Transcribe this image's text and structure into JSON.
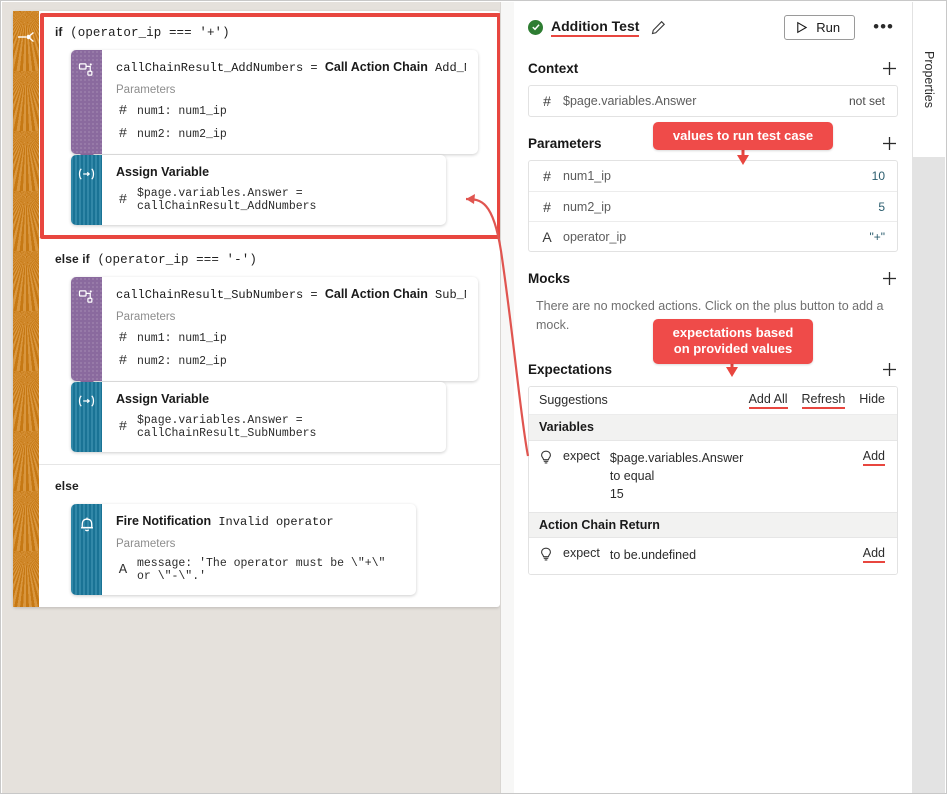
{
  "canvas": {
    "gutter_icon": "action-chain-icon",
    "branches": [
      {
        "label_kw": "if",
        "label_expr": " (operator_ip === '+')",
        "nodes": [
          {
            "strip": "purple",
            "icon": "call-action-chain-icon",
            "title_mono_left": "callChainResult_AddNumbers",
            "title_eq": " = ",
            "title_bold": "Call Action Chain",
            "title_mono_right": " Add_Numbers",
            "params_label": "Parameters",
            "params": [
              {
                "type": "#",
                "text": "num1: num1_ip"
              },
              {
                "type": "#",
                "text": "num2: num2_ip"
              }
            ]
          },
          {
            "strip": "teal",
            "icon": "assign-variable-icon",
            "title_bold": "Assign Variable",
            "assign": {
              "type": "#",
              "text": "$page.variables.Answer = callChainResult_AddNumbers"
            }
          }
        ]
      },
      {
        "label_kw": "else if",
        "label_expr": " (operator_ip === '-')",
        "nodes": [
          {
            "strip": "purple",
            "icon": "call-action-chain-icon",
            "title_mono_left": "callChainResult_SubNumbers",
            "title_eq": " = ",
            "title_bold": "Call Action Chain",
            "title_mono_right": " Sub_Numbers",
            "params_label": "Parameters",
            "params": [
              {
                "type": "#",
                "text": "num1: num1_ip"
              },
              {
                "type": "#",
                "text": "num2: num2_ip"
              }
            ]
          },
          {
            "strip": "teal",
            "icon": "assign-variable-icon",
            "title_bold": "Assign Variable",
            "assign": {
              "type": "#",
              "text": "$page.variables.Answer = callChainResult_SubNumbers"
            }
          }
        ]
      },
      {
        "label_kw": "else",
        "label_expr": "",
        "nodes": [
          {
            "strip": "teal",
            "icon": "bell-icon",
            "title_bold": "Fire Notification",
            "title_mono_right": " Invalid operator",
            "params_label": "Parameters",
            "params": [
              {
                "type": "A",
                "text": "message: 'The operator must be \\\"+\\\" or \\\"-\\\".'"
              }
            ]
          }
        ]
      }
    ]
  },
  "panel": {
    "status_icon": "check-circle-icon",
    "title": "Addition Test",
    "edit_icon": "pencil-icon",
    "run_label": "Run",
    "run_icon": "play-icon",
    "more_icon": "ellipsis-icon",
    "context": {
      "title": "Context",
      "add_icon": "plus-icon",
      "rows": [
        {
          "type": "#",
          "name": "$page.variables.Answer",
          "value": "not set"
        }
      ]
    },
    "parameters": {
      "title": "Parameters",
      "add_icon": "plus-icon",
      "rows": [
        {
          "type": "#",
          "name": "num1_ip",
          "value": "10"
        },
        {
          "type": "#",
          "name": "num2_ip",
          "value": "5"
        },
        {
          "type": "A",
          "name": "operator_ip",
          "value": "\"+\""
        }
      ]
    },
    "mocks": {
      "title": "Mocks",
      "add_icon": "plus-icon",
      "empty_text": "There are no mocked actions. Click on the plus button to add a mock."
    },
    "expectations": {
      "title": "Expectations",
      "add_icon": "plus-icon",
      "suggestions_label": "Suggestions",
      "add_all_label": "Add All",
      "refresh_label": "Refresh",
      "hide_label": "Hide",
      "groups": [
        {
          "name": "Variables",
          "rows": [
            {
              "icon": "lightbulb-icon",
              "keyword": "expect",
              "target": "$page.variables.Answer",
              "matcher": "to equal",
              "value": "15",
              "add_label": "Add"
            }
          ]
        },
        {
          "name": "Action Chain Return",
          "rows": [
            {
              "icon": "lightbulb-icon",
              "keyword": "expect",
              "target": "to be.undefined",
              "matcher": "",
              "value": "",
              "add_label": "Add"
            }
          ]
        }
      ]
    }
  },
  "properties_tab": {
    "label": "Properties"
  },
  "annotations": [
    {
      "text": "values to run test case"
    },
    {
      "text": "expectations based\non provided values"
    }
  ],
  "colors": {
    "accent_red": "#ef4b49",
    "purple_node": "#8a6a9e",
    "teal_node": "#1b7a9e",
    "gutter_orange": "#cf7f15",
    "status_green": "#2e7d32"
  }
}
